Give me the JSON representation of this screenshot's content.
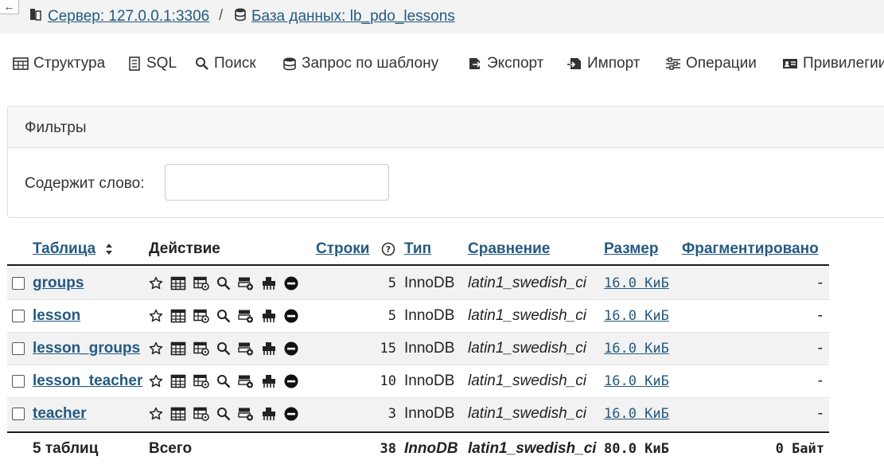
{
  "breadcrumb": {
    "back": "←",
    "server": "Сервер: 127.0.0.1:3306",
    "separator": "/",
    "database": "База данных: lb_pdo_lessons"
  },
  "tabs": [
    {
      "label": "Структура",
      "icon": "structure-icon"
    },
    {
      "label": "SQL",
      "icon": "sql-icon"
    },
    {
      "label": "Поиск",
      "icon": "search-icon"
    },
    {
      "label": "Запрос по шаблону",
      "icon": "database-query-icon"
    },
    {
      "label": "Экспорт",
      "icon": "export-icon"
    },
    {
      "label": "Импорт",
      "icon": "import-icon"
    },
    {
      "label": "Операции",
      "icon": "operations-icon"
    },
    {
      "label": "Привилегии",
      "icon": "privileges-icon"
    }
  ],
  "filters": {
    "title": "Фильтры",
    "contains_label": "Содержит слово:",
    "contains_value": ""
  },
  "table": {
    "headers": {
      "table": "Таблица",
      "action": "Действие",
      "rows": "Строки",
      "rows_help": "?",
      "type": "Тип",
      "collation": "Сравнение",
      "size": "Размер",
      "overhead": "Фрагментировано"
    },
    "rows": [
      {
        "name": "groups",
        "rows": "5",
        "type": "InnoDB",
        "collation": "latin1_swedish_ci",
        "size": "16.0 КиБ",
        "overhead": "-"
      },
      {
        "name": "lesson",
        "rows": "5",
        "type": "InnoDB",
        "collation": "latin1_swedish_ci",
        "size": "16.0 КиБ",
        "overhead": "-"
      },
      {
        "name": "lesson_groups",
        "rows": "15",
        "type": "InnoDB",
        "collation": "latin1_swedish_ci",
        "size": "16.0 КиБ",
        "overhead": "-"
      },
      {
        "name": "lesson_teacher",
        "rows": "10",
        "type": "InnoDB",
        "collation": "latin1_swedish_ci",
        "size": "16.0 КиБ",
        "overhead": "-"
      },
      {
        "name": "teacher",
        "rows": "3",
        "type": "InnoDB",
        "collation": "latin1_swedish_ci",
        "size": "16.0 КиБ",
        "overhead": "-"
      }
    ],
    "total": {
      "count_label": "5 таблиц",
      "sum_label": "Всего",
      "rows": "38",
      "type": "InnoDB",
      "collation": "latin1_swedish_ci",
      "size": "80.0 КиБ",
      "overhead": "0 Байт"
    }
  },
  "colors": {
    "link": "#235a81",
    "row_alt": "#f2f2f2"
  }
}
